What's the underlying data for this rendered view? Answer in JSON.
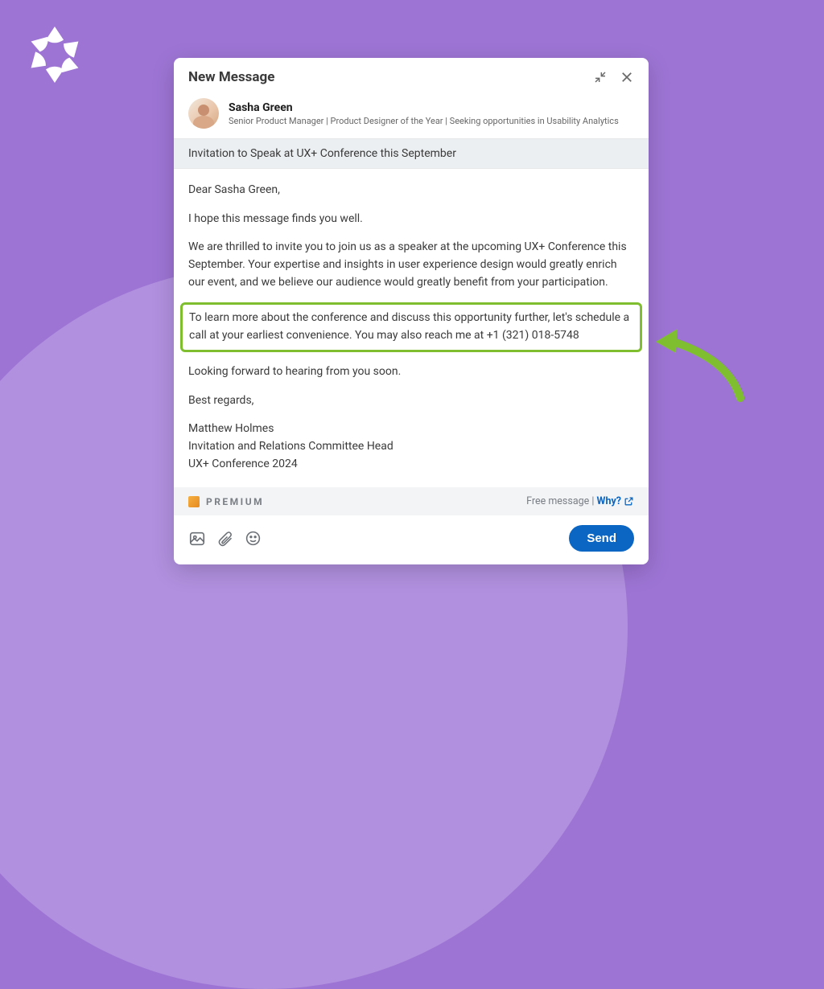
{
  "modal": {
    "title": "New Message",
    "recipient": {
      "name": "Sasha Green",
      "headline": "Senior Product Manager | Product Designer of the Year | Seeking opportunities in Usability Analytics"
    },
    "subject": "Invitation to Speak at UX+ Conference this September",
    "body": {
      "greeting": "Dear Sasha Green,",
      "intro": "I hope this message finds you well.",
      "para1": "We are thrilled to invite you to join us as a speaker at the upcoming UX+ Conference this September. Your expertise and insights in user experience design would greatly enrich our event, and we believe our audience would greatly benefit from your participation.",
      "highlighted": "To learn more about the conference and discuss this opportunity further, let's schedule a call at your earliest convenience. You may also reach me at +1 (321) 018-5748",
      "closing": "Looking forward to hearing from you soon.",
      "signoff": "Best regards,",
      "sig_name": "Matthew Holmes",
      "sig_title": "Invitation and Relations Committee Head",
      "sig_org": "UX+ Conference 2024"
    },
    "premium_label": "PREMIUM",
    "free_message_label": "Free message",
    "why_label": "Why?",
    "send_label": "Send"
  },
  "colors": {
    "accent_purple": "#9d74d4",
    "highlight_green": "#7fbf2f",
    "link_blue": "#0a66c2"
  }
}
